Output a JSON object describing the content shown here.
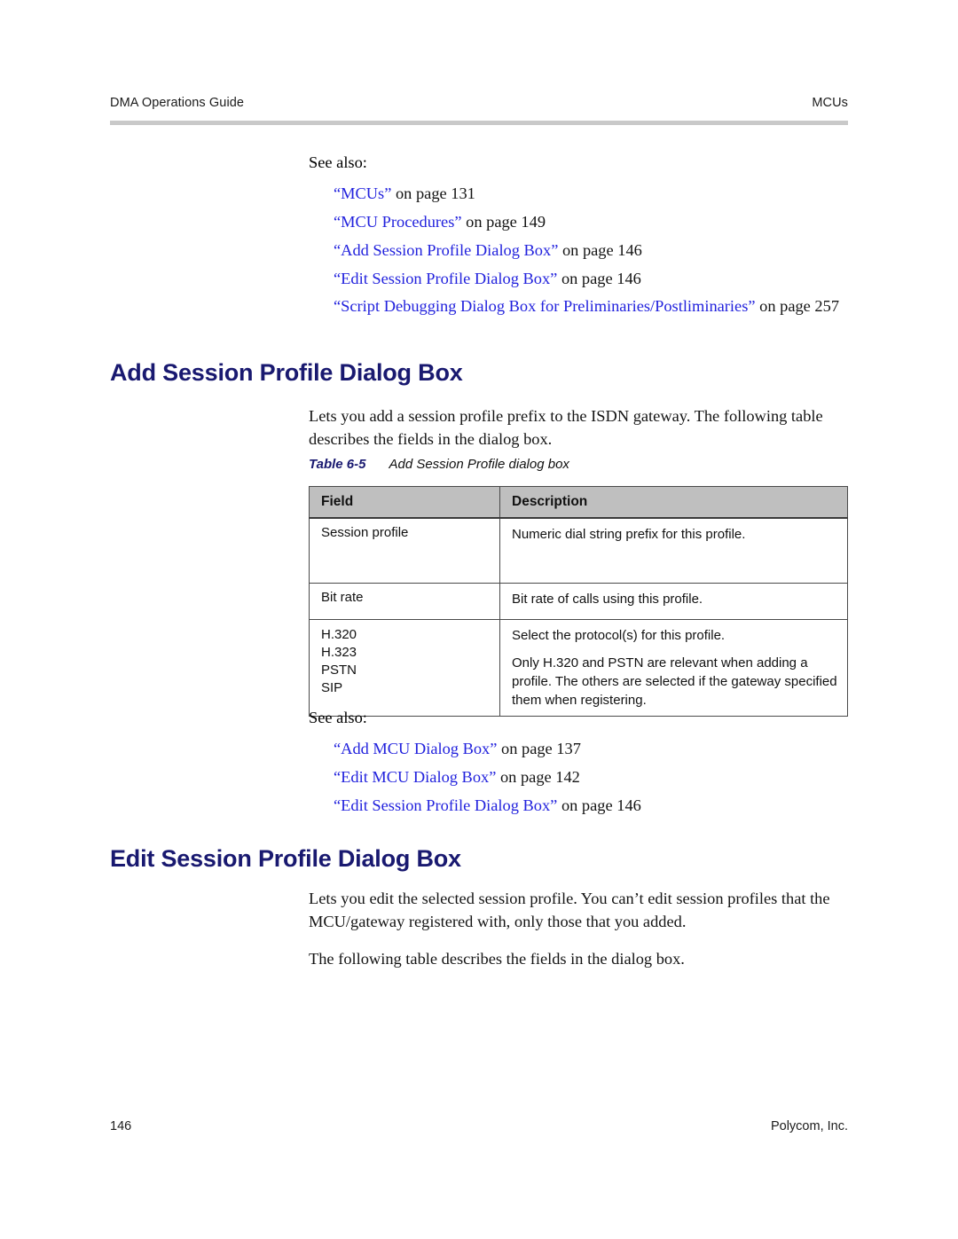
{
  "header": {
    "left": "DMA Operations Guide",
    "right": "MCUs"
  },
  "see_also_1": {
    "label": "See also:",
    "items": [
      {
        "link": "“MCUs”",
        "suffix": " on page 131"
      },
      {
        "link": "“MCU Procedures”",
        "suffix": " on page 149"
      },
      {
        "link": "“Add Session Profile Dialog Box”",
        "suffix": " on page 146"
      },
      {
        "link": "“Edit Session Profile Dialog Box”",
        "suffix": " on page 146"
      },
      {
        "link": "“Script Debugging Dialog Box for Preliminaries/Postliminaries”",
        "suffix": " on page 257"
      }
    ]
  },
  "section_add": {
    "heading": "Add Session Profile Dialog Box",
    "intro": "Lets you add a session profile prefix to the ISDN gateway. The following table describes the fields in the dialog box."
  },
  "table_6_5": {
    "number": "Table 6-5",
    "title": "Add Session Profile dialog box",
    "columns": [
      "Field",
      "Description"
    ],
    "rows": [
      {
        "field": "Session profile",
        "description": [
          "Numeric dial string prefix for this profile."
        ]
      },
      {
        "field": "Bit rate",
        "description": [
          "Bit rate of calls using this profile."
        ]
      },
      {
        "field_options": [
          "H.320",
          "H.323",
          "PSTN",
          "SIP"
        ],
        "description": [
          "Select the protocol(s) for this profile.",
          "Only H.320 and PSTN are relevant when adding a profile. The others are selected if the gateway specified them when registering."
        ]
      }
    ]
  },
  "see_also_2": {
    "label": "See also:",
    "items": [
      {
        "link": "“Add MCU Dialog Box”",
        "suffix": " on page 137"
      },
      {
        "link": "“Edit MCU Dialog Box”",
        "suffix": " on page 142"
      },
      {
        "link": "“Edit Session Profile Dialog Box”",
        "suffix": " on page 146"
      }
    ]
  },
  "section_edit": {
    "heading": "Edit Session Profile Dialog Box",
    "para1": "Lets you edit the selected session profile. You can’t edit session profiles that the MCU/gateway registered with, only those that you added.",
    "para2": "The following table describes the fields in the dialog box."
  },
  "footer": {
    "page_number": "146",
    "company": "Polycom, Inc."
  },
  "colors": {
    "heading_navy": "#191970",
    "link_blue": "#2222dd",
    "table_header_bg": "#bfbfbf",
    "rule_gray": "#c9c9c9"
  }
}
